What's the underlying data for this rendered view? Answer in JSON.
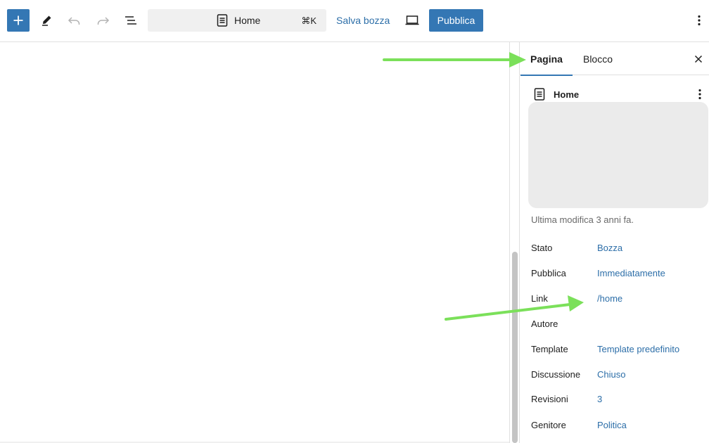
{
  "toolbar": {
    "command_title": "Home",
    "command_shortcut": "⌘K",
    "save_draft_label": "Salva bozza",
    "publish_label": "Pubblica"
  },
  "sidebar": {
    "tabs": [
      {
        "label": "Pagina",
        "active": true
      },
      {
        "label": "Blocco",
        "active": false
      }
    ],
    "post_title": "Home",
    "last_modified": "Ultima modifica 3 anni fa.",
    "meta": [
      {
        "label": "Stato",
        "value": "Bozza"
      },
      {
        "label": "Pubblica",
        "value": "Immediatamente"
      },
      {
        "label": "Link",
        "value": "/home"
      },
      {
        "label": "Autore",
        "value": ""
      },
      {
        "label": "Template",
        "value": "Template predefinito"
      },
      {
        "label": "Discussione",
        "value": "Chiuso"
      },
      {
        "label": "Revisioni",
        "value": "3"
      },
      {
        "label": "Genitore",
        "value": "Politica"
      }
    ]
  },
  "colors": {
    "accent": "#3477b4",
    "link": "#2c6ea8",
    "arrow": "#7be05a"
  },
  "icons": [
    "plus-icon",
    "pencil-icon",
    "undo-icon",
    "redo-icon",
    "list-view-icon",
    "document-icon",
    "laptop-icon",
    "vertical-dots-icon",
    "close-icon"
  ]
}
